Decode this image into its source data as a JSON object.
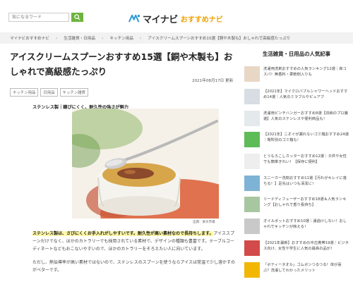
{
  "header": {
    "search_placeholder": "気になるワード",
    "logo_text": "マイナビ",
    "logo_sub": "おすすめナビ"
  },
  "breadcrumb": [
    "マイナビおすすめナビ",
    "生活雑貨・日用品",
    "キッチン用品",
    "アイスクリームスプーンおすすめ15選【銅や木製も】おしゃれで高級感たっぷり"
  ],
  "article": {
    "title": "アイスクリームスプーンおすすめ15選【銅や木製も】おしゃれで高級感たっぷり",
    "date": "2021年08月17日 更新",
    "tags": [
      "キッチン用品",
      "日用品",
      "キッチン雑貨"
    ],
    "lead": "ステンレス製｜錆びにくく、耐久性の強さが魅力",
    "photo_credit": "出典：楽天市場",
    "body_highlight": "ステンレス製は、さびにくくお手入れがしやすいです。耐久性が高い素材なので長持ちします。",
    "body_rest": "アイススプーンだけでなく、ほかのカトラリーでも採用されている素材で、デザインの種類も豊富です。テーブルコーディネートなどもおこないやすいので、ほかのカトラリーをそろえたい人に向いています。",
    "body2": "ただし、熱伝導率が高い素材ではないので、ステンレスのスプーンを使うならアイスは常温で少し溶かすのがベターです。"
  },
  "sidebar": {
    "title": "生活雑貨・日用品の人気記事",
    "items": [
      {
        "text": "洗濯用洗剤おすすめの人気ランキング12選｜高コスパ！無香料・柔軟剤入りも",
        "thumb_color": "#e8d7c4"
      },
      {
        "text": "【2021年】マイクロバブルシャワーヘッドおすすめ14選｜人気のミラブルやピュアブ",
        "thumb_color": "#d8dde3"
      },
      {
        "text": "洗濯用ピンチハンガーおすすめ8選【収納のプロ厳選】人気のステンレスや便利商品も！",
        "thumb_color": "#e4e9ec"
      },
      {
        "text": "【2021年】ニオイが漏れないゴミ箱おすすめ24選｜場所別のゴミ箱も！",
        "thumb_color": "#5dbb58"
      },
      {
        "text": "とうもろこしカッターおすすめ12選｜子供や女性でも簡単きれい！【保存に便利】",
        "thumb_color": "#eeeeee"
      },
      {
        "text": "スニーカー洗剤おすすめ11選【汚れがキレイに落ちる！】足先はいつも清潔に！",
        "thumb_color": "#7fb3d6"
      },
      {
        "text": "リードディフューザーおすすめ18選＆人気ランキング【おしゃれで香り長持ち】",
        "thumb_color": "#a7c7a0"
      },
      {
        "text": "オイルポットおすすめ10選｜濾過けしない！おしゃれでキッチンが映える！",
        "thumb_color": "#c9c9c9"
      },
      {
        "text": "【2021年最新】おすすめの中古携帯19選｜ビジネス向け、女性や学生に人気の最高の品が！",
        "thumb_color": "#d24a4a"
      },
      {
        "text": "「ボティータオル」ゴムボンつるつる！体が喜ぶ？洗濯してわかったメリット",
        "thumb_color": "#f2b705"
      }
    ]
  },
  "colors": {
    "accent_green": "#6cb33f",
    "logo_orange": "#f0a000",
    "highlight_yellow": "#fff8a8"
  }
}
